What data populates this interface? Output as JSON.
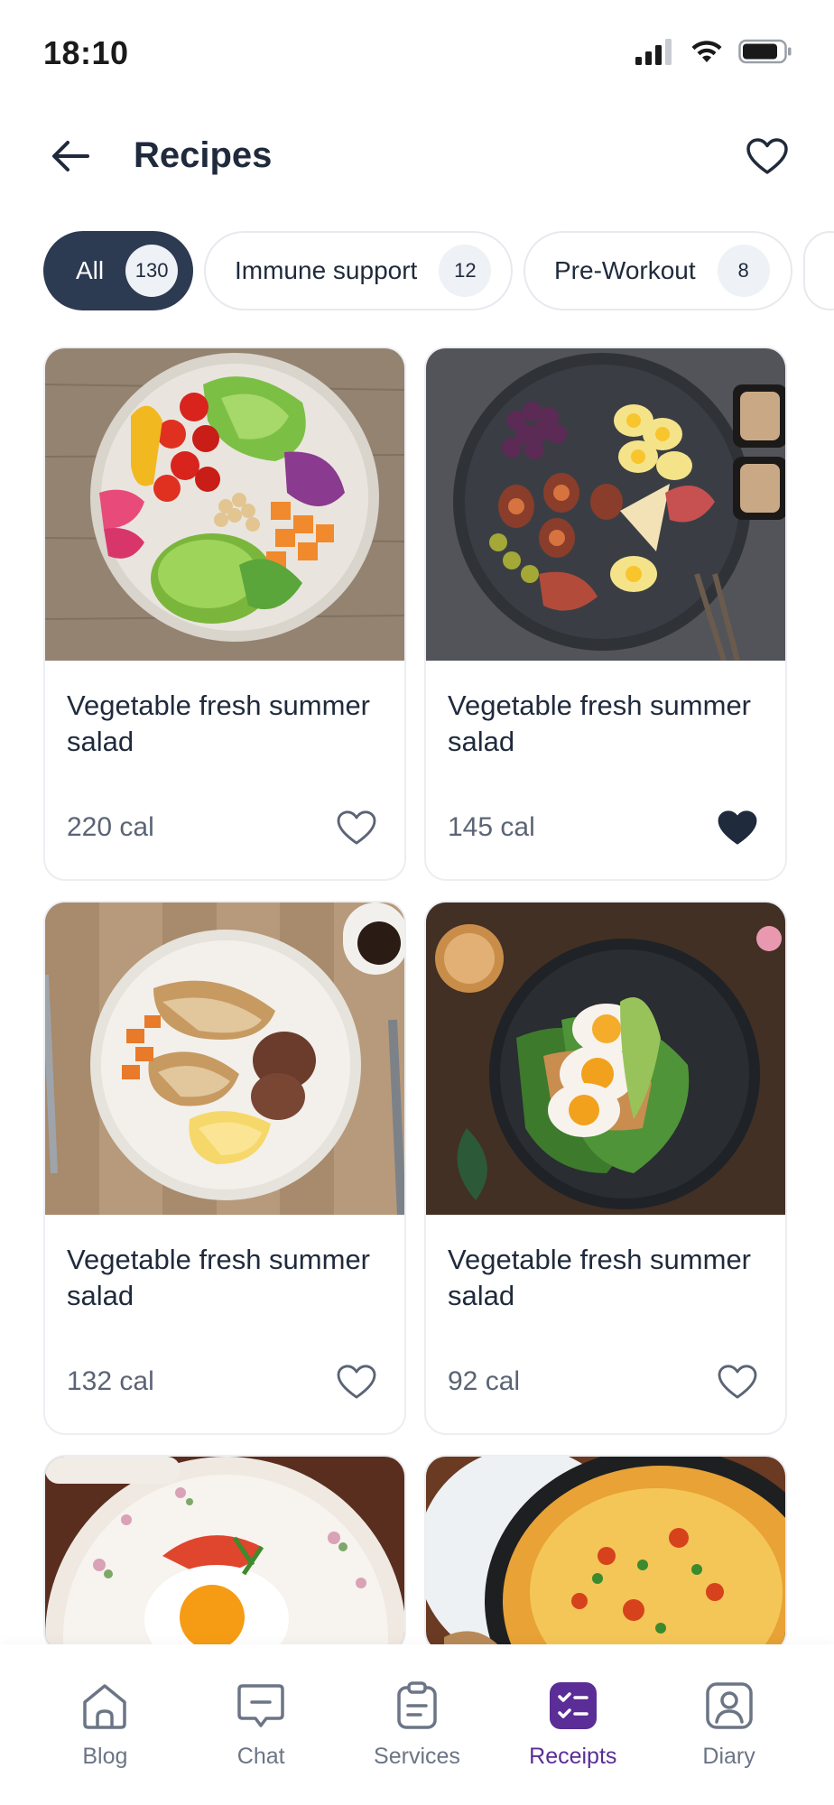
{
  "status": {
    "time": "18:10"
  },
  "header": {
    "title": "Recipes"
  },
  "filters": [
    {
      "label": "All",
      "count": "130",
      "active": true
    },
    {
      "label": "Immune support",
      "count": "12",
      "active": false
    },
    {
      "label": "Pre-Workout",
      "count": "8",
      "active": false
    }
  ],
  "recipes": [
    {
      "title": "Vegetable fresh summer salad",
      "calories": "220 cal",
      "liked": false,
      "image": "salad-bowl"
    },
    {
      "title": "Vegetable fresh summer salad",
      "calories": "145 cal",
      "liked": true,
      "image": "charcuterie-plate"
    },
    {
      "title": "Vegetable fresh summer salad",
      "calories": "132 cal",
      "liked": false,
      "image": "breakfast-plate"
    },
    {
      "title": "Vegetable fresh summer salad",
      "calories": "92 cal",
      "liked": false,
      "image": "egg-toast"
    },
    {
      "image": "fried-egg-plate"
    },
    {
      "image": "baked-skillet"
    }
  ],
  "nav": [
    {
      "label": "Blog",
      "icon": "home-icon",
      "active": false
    },
    {
      "label": "Chat",
      "icon": "chat-icon",
      "active": false
    },
    {
      "label": "Services",
      "icon": "clipboard-icon",
      "active": false
    },
    {
      "label": "Receipts",
      "icon": "checklist-icon",
      "active": true
    },
    {
      "label": "Diary",
      "icon": "profile-icon",
      "active": false
    }
  ],
  "colors": {
    "primary": "#2c3a52",
    "accent": "#5b2d96",
    "text": "#1f2a3c",
    "muted": "#6c7585"
  }
}
